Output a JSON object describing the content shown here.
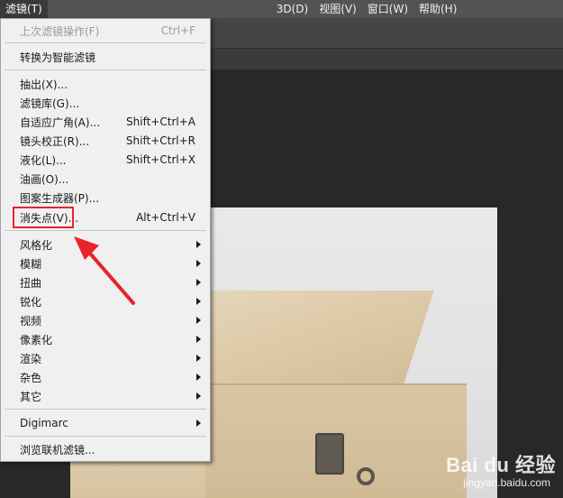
{
  "menubar": {
    "items": [
      {
        "label": "滤镜(T)",
        "active": true
      },
      {
        "label": "3D(D)"
      },
      {
        "label": "视图(V)"
      },
      {
        "label": "窗口(W)"
      },
      {
        "label": "帮助(H)"
      }
    ]
  },
  "filter_menu": {
    "last_filter": {
      "label": "上次滤镜操作(F)",
      "shortcut": "Ctrl+F"
    },
    "convert_smart": "转换为智能滤镜",
    "extract": "抽出(X)...",
    "gallery": "滤镜库(G)...",
    "adaptive_wide": {
      "label": "自适应广角(A)...",
      "shortcut": "Shift+Ctrl+A"
    },
    "lens_correction": {
      "label": "镜头校正(R)...",
      "shortcut": "Shift+Ctrl+R"
    },
    "liquify": {
      "label": "液化(L)...",
      "shortcut": "Shift+Ctrl+X"
    },
    "oil_paint": "油画(O)...",
    "pattern_maker": "图案生成器(P)...",
    "vanishing_point": {
      "label": "消失点(V)...",
      "shortcut": "Alt+Ctrl+V"
    },
    "submenus": [
      "风格化",
      "模糊",
      "扭曲",
      "锐化",
      "视频",
      "像素化",
      "渲染",
      "杂色",
      "其它"
    ],
    "digimarc": "Digimarc",
    "browse_online": "浏览联机滤镜..."
  },
  "watermark": {
    "logo": "Bai du 经验",
    "url": "jingyan.baidu.com"
  },
  "colors": {
    "highlight": "#e8242a",
    "menu_bg": "#f0f0f0",
    "app_bg": "#282828"
  }
}
